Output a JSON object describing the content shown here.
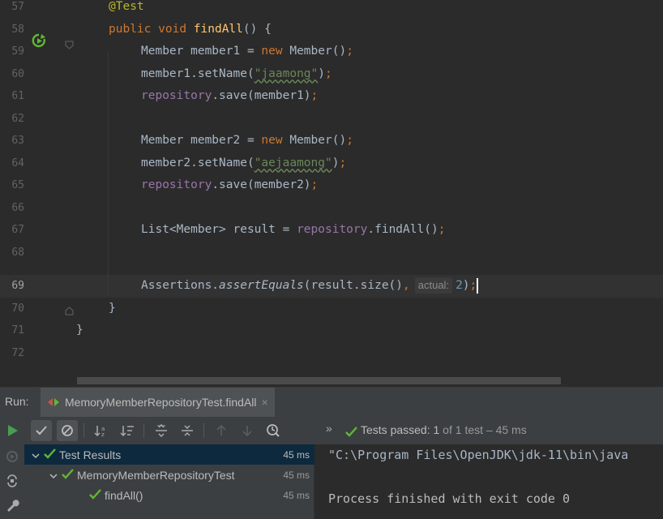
{
  "editor": {
    "line_numbers": [
      "57",
      "58",
      "59",
      "60",
      "61",
      "62",
      "63",
      "64",
      "65",
      "66",
      "67",
      "68",
      "69",
      "70",
      "71",
      "72"
    ],
    "current_line": "69",
    "code": {
      "l57_annotation": "@Test",
      "l58_public": "public",
      "l58_void": "void",
      "l58_method": "findAll",
      "l58_rest": "() {",
      "l59_a": "Member member1 = ",
      "l59_new": "new",
      "l59_b": " Member()",
      "semi": ";",
      "l60_a": "member1.setName(",
      "l60_str": "\"jaamong\"",
      "l60_b": ")",
      "l61_field": "repository",
      "l61_b": ".save(member1)",
      "l63_a": "Member member2 = ",
      "l63_new": "new",
      "l63_b": " Member()",
      "l64_a": "member2.setName(",
      "l64_str": "\"aejaamong\"",
      "l64_b": ")",
      "l65_field": "repository",
      "l65_b": ".save(member2)",
      "l67_a": "List<Member> result = ",
      "l67_field": "repository",
      "l67_b": ".findAll()",
      "l69_a": "Assertions.",
      "l69_italic": "assertEquals",
      "l69_b": "(result.size()",
      "l69_comma": ",",
      "l69_hint": "actual:",
      "l69_num": "2",
      "l69_c": ")",
      "l70": "}",
      "l71": "}"
    }
  },
  "run_panel": {
    "label": "Run:",
    "tab_title": "MemoryMemberRepositoryTest.findAll",
    "tab_close": "×",
    "chevron": "»",
    "status": {
      "prefix": "Tests passed: ",
      "passed": "1",
      "middle": " of ",
      "total": "1 test",
      "suffix": " – 45 ms"
    },
    "tree": [
      {
        "label": "Test Results",
        "time": "45 ms"
      },
      {
        "label": "MemoryMemberRepositoryTest",
        "time": "45 ms"
      },
      {
        "label": "findAll()",
        "time": "45 ms"
      }
    ],
    "console": {
      "command": "\"C:\\Program Files\\OpenJDK\\jdk-11\\bin\\java",
      "exit": "Process finished with exit code 0"
    }
  },
  "colors": {
    "pass_green": "#5fb832",
    "keyword": "#cc7832",
    "annotation": "#bbb529",
    "string": "#6a8759",
    "field": "#9876aa",
    "number": "#6897bb"
  },
  "icons": [
    "run-test-icon",
    "fold-icon",
    "run-icon",
    "show-passed-icon",
    "show-ignored-icon",
    "sort-alpha-icon",
    "sort-duration-icon",
    "expand-all-icon",
    "collapse-all-icon",
    "prev-fail-icon",
    "next-fail-icon",
    "history-icon",
    "rerun-failed-icon",
    "toggle-auto-test-icon",
    "settings-wrench-icon",
    "pass-check-icon"
  ]
}
